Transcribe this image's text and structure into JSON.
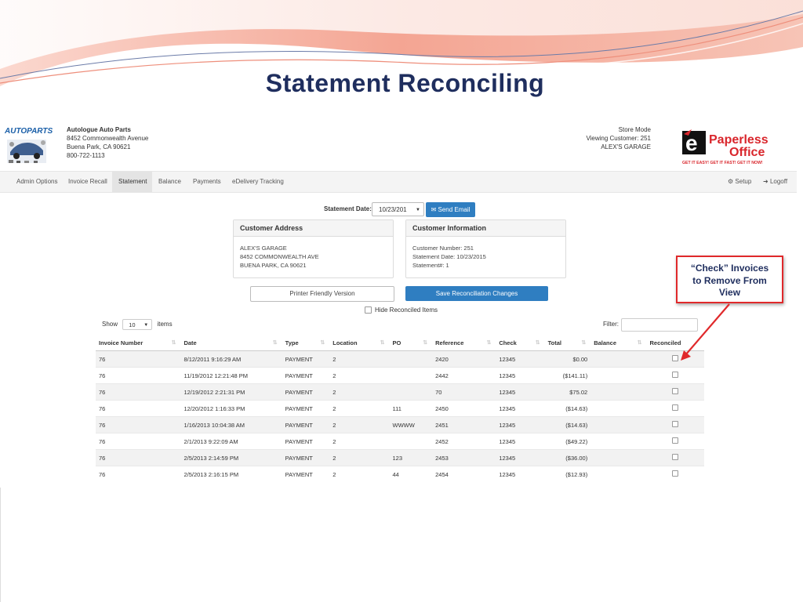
{
  "slide": {
    "title": "Statement  Reconciling"
  },
  "header": {
    "logo_text": "AUTOPARTS",
    "company_name": "Autologue Auto Parts",
    "address_line1": "8452 Commonwealth Avenue",
    "address_line2": "Buena Park, CA 90621",
    "phone": "800-722-1113",
    "store_mode": "Store Mode",
    "viewing_customer": "Viewing Customer: 251",
    "customer_name": "ALEX'S GARAGE"
  },
  "nav": {
    "items": [
      {
        "label": "Admin Options"
      },
      {
        "label": "Invoice Recall"
      },
      {
        "label": "Statement"
      },
      {
        "label": "Balance"
      },
      {
        "label": "Payments"
      },
      {
        "label": "eDelivery Tracking"
      }
    ],
    "setup_label": "Setup",
    "logoff_label": "Logoff"
  },
  "statement": {
    "date_label": "Statement Date:",
    "date_value": "10/23/201",
    "send_email_label": "Send Email"
  },
  "customer_address": {
    "heading": "Customer Address",
    "line1": "ALEX'S GARAGE",
    "line2": "8452 COMMONWEALTH AVE",
    "line3": "BUENA PARK, CA 90621"
  },
  "customer_information": {
    "heading": "Customer Information",
    "line1": "Customer Number: 251",
    "line2": "Statement Date: 10/23/2015",
    "line3": "Statement#: 1"
  },
  "actions": {
    "printer_label": "Printer Friendly Version",
    "save_label": "Save Reconciliation Changes",
    "hide_reconciled_label": "Hide Reconciled Items"
  },
  "table_controls": {
    "show_label": "Show",
    "show_value": "10",
    "items_label": "items",
    "filter_label": "Filter:"
  },
  "table": {
    "columns": [
      "Invoice Number",
      "Date",
      "Type",
      "Location",
      "PO",
      "Reference",
      "Check",
      "Total",
      "Balance",
      "Reconciled"
    ],
    "rows": [
      {
        "invoice": "76",
        "date": "8/12/2011 9:16:29 AM",
        "type": "PAYMENT",
        "location": "2",
        "po": "",
        "reference": "2420",
        "check": "12345",
        "total": "$0.00",
        "balance": ""
      },
      {
        "invoice": "76",
        "date": "11/19/2012 12:21:48 PM",
        "type": "PAYMENT",
        "location": "2",
        "po": "",
        "reference": "2442",
        "check": "12345",
        "total": "($141.11)",
        "balance": ""
      },
      {
        "invoice": "76",
        "date": "12/19/2012 2:21:31 PM",
        "type": "PAYMENT",
        "location": "2",
        "po": "",
        "reference": "70",
        "check": "12345",
        "total": "$75.02",
        "balance": ""
      },
      {
        "invoice": "76",
        "date": "12/20/2012 1:16:33 PM",
        "type": "PAYMENT",
        "location": "2",
        "po": "111",
        "reference": "2450",
        "check": "12345",
        "total": "($14.63)",
        "balance": ""
      },
      {
        "invoice": "76",
        "date": "1/16/2013 10:04:38 AM",
        "type": "PAYMENT",
        "location": "2",
        "po": "WWWW",
        "reference": "2451",
        "check": "12345",
        "total": "($14.63)",
        "balance": ""
      },
      {
        "invoice": "76",
        "date": "2/1/2013 9:22:09 AM",
        "type": "PAYMENT",
        "location": "2",
        "po": "",
        "reference": "2452",
        "check": "12345",
        "total": "($49.22)",
        "balance": ""
      },
      {
        "invoice": "76",
        "date": "2/5/2013 2:14:59 PM",
        "type": "PAYMENT",
        "location": "2",
        "po": "123",
        "reference": "2453",
        "check": "12345",
        "total": "($36.00)",
        "balance": ""
      },
      {
        "invoice": "76",
        "date": "2/5/2013 2:16:15 PM",
        "type": "PAYMENT",
        "location": "2",
        "po": "44",
        "reference": "2454",
        "check": "12345",
        "total": "($12.93)",
        "balance": ""
      }
    ]
  },
  "callout": {
    "line1": "“Check” Invoices",
    "line2": "to Remove From",
    "line3": "View"
  },
  "colors": {
    "title": "#1f2e5e",
    "primary_button": "#2f7ec1",
    "callout_border": "#e0292b",
    "swoosh_salmon": "#ee8f7c"
  },
  "icons": {
    "send_email": "envelope-icon",
    "setup": "gear-icon",
    "logoff": "logout-icon"
  }
}
